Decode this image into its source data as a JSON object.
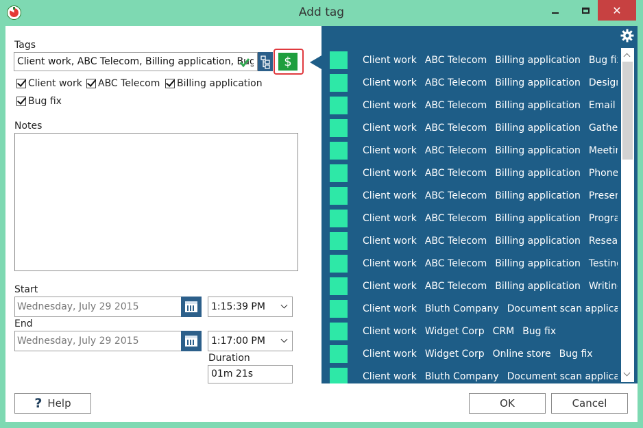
{
  "window": {
    "title": "Add tag",
    "close_glyph": "✕"
  },
  "form": {
    "tags_label": "Tags",
    "tags_value": "Client work, ABC Telecom, Billing application, Bug fix",
    "billable_symbol": "$",
    "tag_checks": [
      "Client work",
      "ABC Telecom",
      "Billing application",
      "Bug fix"
    ],
    "notes_label": "Notes",
    "start_label": "Start",
    "start_date": "Wednesday, July 29 2015",
    "start_time": "1:15:39 PM",
    "end_label": "End",
    "end_date": "Wednesday, July 29 2015",
    "end_time": "1:17:00 PM",
    "duration_label": "Duration",
    "duration_value": "01m 21s"
  },
  "buttons": {
    "help": "Help",
    "help_glyph": "?",
    "ok": "OK",
    "cancel": "Cancel"
  },
  "colors": {
    "panel": "#1e5d87",
    "swatch": "#2ee8a7",
    "billable": "#1e9e3e",
    "window": "#7ed9b2"
  },
  "tag_list": [
    [
      "Client work",
      "ABC Telecom",
      "Billing application",
      "Bug fix"
    ],
    [
      "Client work",
      "ABC Telecom",
      "Billing application",
      "Design"
    ],
    [
      "Client work",
      "ABC Telecom",
      "Billing application",
      "Email"
    ],
    [
      "Client work",
      "ABC Telecom",
      "Billing application",
      "Gathering i"
    ],
    [
      "Client work",
      "ABC Telecom",
      "Billing application",
      "Meeting"
    ],
    [
      "Client work",
      "ABC Telecom",
      "Billing application",
      "Phone"
    ],
    [
      "Client work",
      "ABC Telecom",
      "Billing application",
      "Presentatio"
    ],
    [
      "Client work",
      "ABC Telecom",
      "Billing application",
      "Programmi"
    ],
    [
      "Client work",
      "ABC Telecom",
      "Billing application",
      "Research"
    ],
    [
      "Client work",
      "ABC Telecom",
      "Billing application",
      "Testing"
    ],
    [
      "Client work",
      "ABC Telecom",
      "Billing application",
      "Writing doc"
    ],
    [
      "Client work",
      "Bluth Company",
      "Document scan application"
    ],
    [
      "Client work",
      "Widget Corp",
      "CRM",
      "Bug fix"
    ],
    [
      "Client work",
      "Widget Corp",
      "Online store",
      "Bug fix"
    ],
    [
      "Client work",
      "Bluth Company",
      "Document scan application"
    ]
  ]
}
